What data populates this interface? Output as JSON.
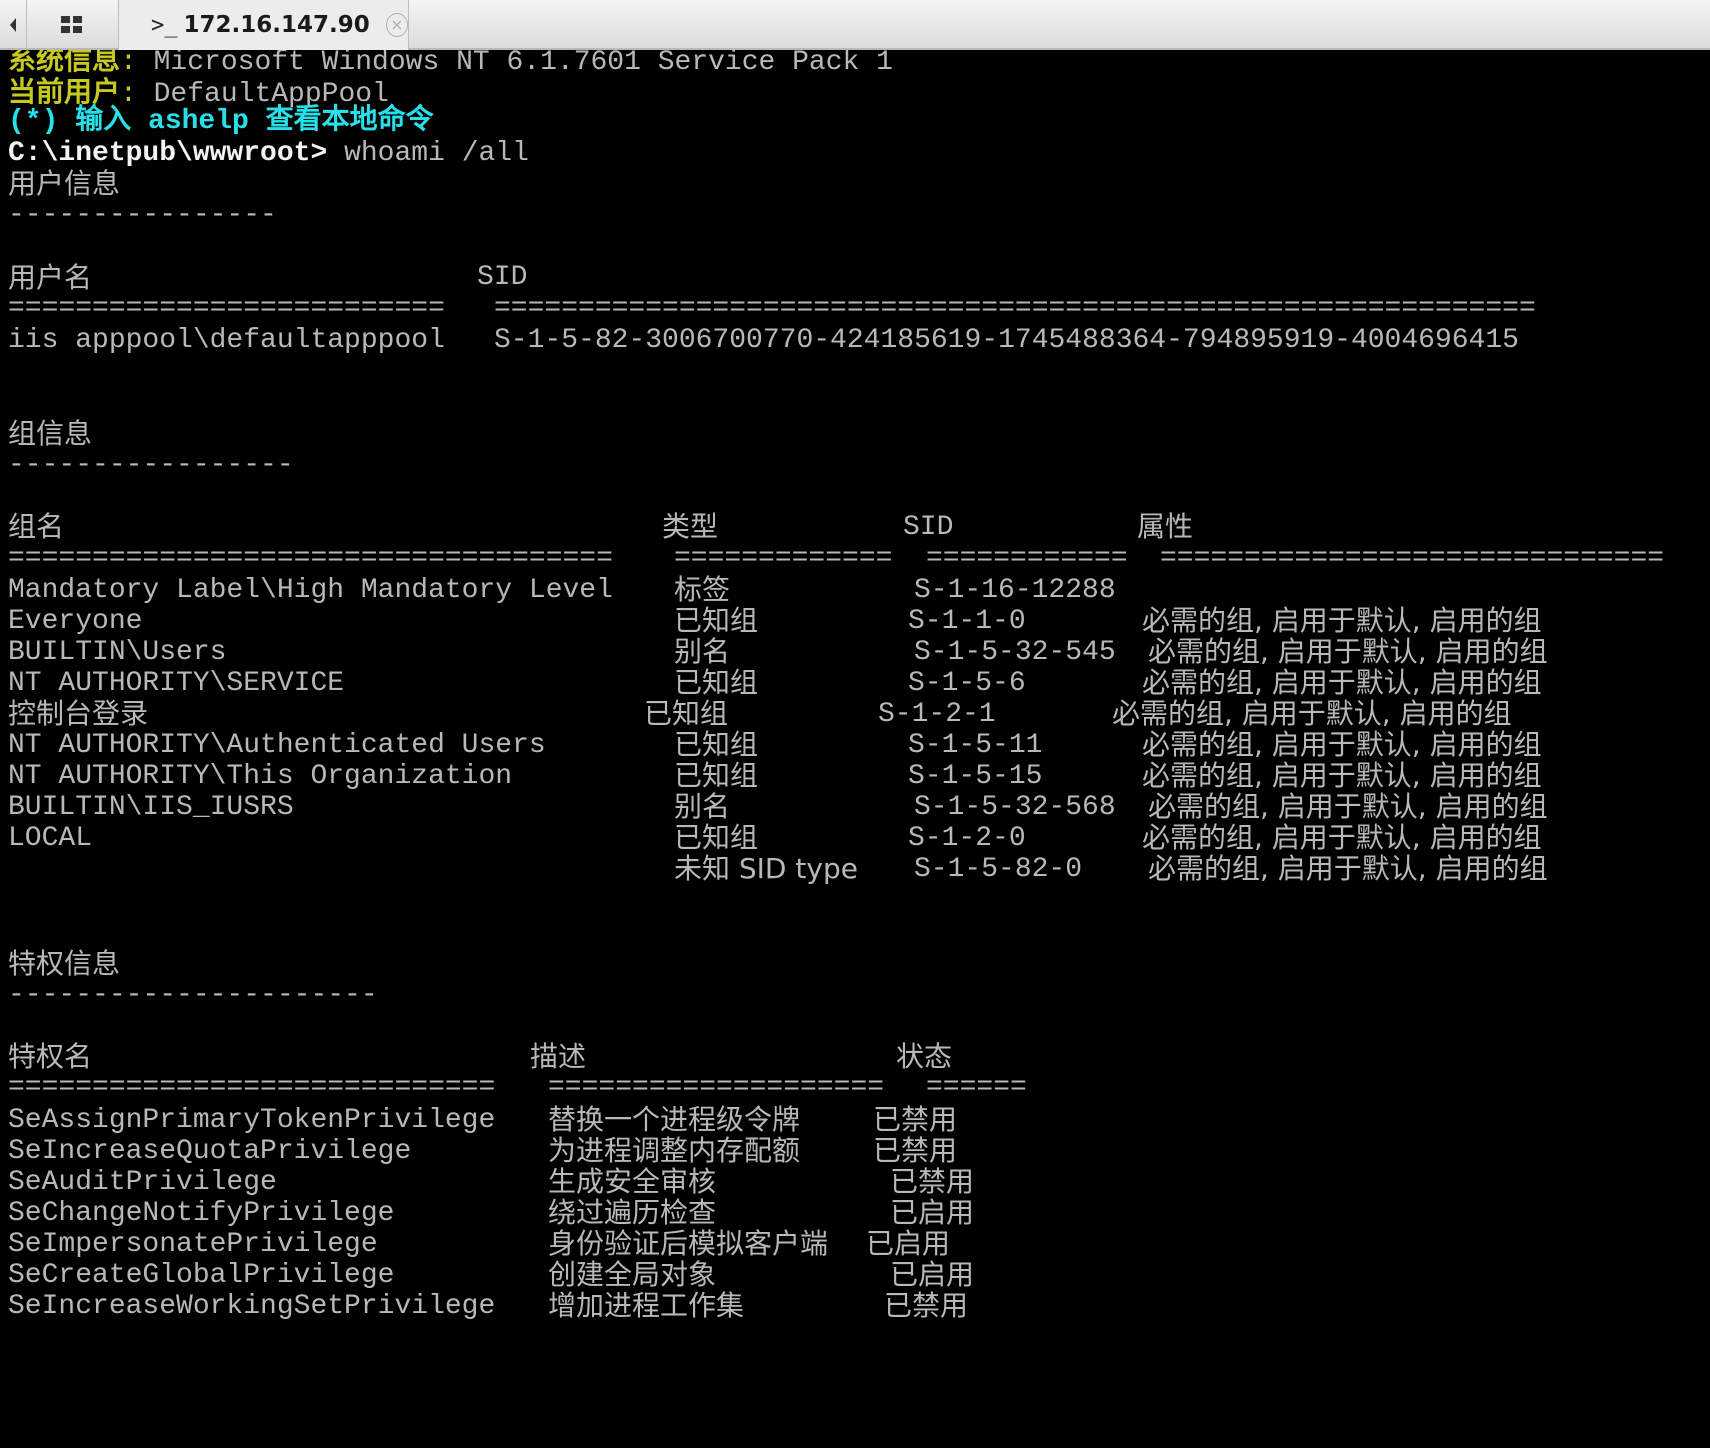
{
  "tab": {
    "title": "172.16.147.90",
    "prompt_icon": ">_",
    "close_icon": "×"
  },
  "banner": {
    "sysinfo_label": "系统信息",
    "sysinfo_value": "Microsoft Windows NT 6.1.7601 Service Pack 1",
    "user_label": "当前用户",
    "user_value": "DefaultAppPool",
    "hint": "(*) 输入 ashelp 查看本地命令",
    "prompt": "C:\\inetpub\\wwwroot>",
    "command": "whoami /all"
  },
  "user_info": {
    "title": "用户信息",
    "underline": "----------------",
    "col_name": "用户名",
    "col_sid": "SID",
    "sep_name": "==========================",
    "sep_sid": "==============================================================",
    "name": "iis apppool\\defaultapppool",
    "sid": "S-1-5-82-3006700770-424185619-1745488364-794895919-4004696415"
  },
  "group_info": {
    "title": "组信息",
    "underline": "-----------------",
    "col_name": "组名",
    "col_type": "类型",
    "col_sid": "SID",
    "col_attr": "属性",
    "sep_name": "====================================",
    "sep_type": "=============",
    "sep_sid": "============",
    "sep_attr": "==============================",
    "rows": [
      {
        "name": "Mandatory Label\\High Mandatory Level",
        "type": "标签",
        "sid": "S-1-16-12288",
        "attr": ""
      },
      {
        "name": "Everyone",
        "type": "已知组",
        "sid": "S-1-1-0",
        "attr": "必需的组, 启用于默认, 启用的组"
      },
      {
        "name": "BUILTIN\\Users",
        "type": "别名",
        "sid": "S-1-5-32-545",
        "attr": "必需的组, 启用于默认, 启用的组"
      },
      {
        "name": "NT AUTHORITY\\SERVICE",
        "type": "已知组",
        "sid": "S-1-5-6",
        "attr": "必需的组, 启用于默认, 启用的组"
      },
      {
        "name": "控制台登录",
        "type": "已知组",
        "sid": "S-1-2-1",
        "attr": "必需的组, 启用于默认, 启用的组"
      },
      {
        "name": "NT AUTHORITY\\Authenticated Users",
        "type": "已知组",
        "sid": "S-1-5-11",
        "attr": "必需的组, 启用于默认, 启用的组"
      },
      {
        "name": "NT AUTHORITY\\This Organization",
        "type": "已知组",
        "sid": "S-1-5-15",
        "attr": "必需的组, 启用于默认, 启用的组"
      },
      {
        "name": "BUILTIN\\IIS_IUSRS",
        "type": "别名",
        "sid": "S-1-5-32-568",
        "attr": "必需的组, 启用于默认, 启用的组"
      },
      {
        "name": "LOCAL",
        "type": "已知组",
        "sid": "S-1-2-0",
        "attr": "必需的组, 启用于默认, 启用的组"
      },
      {
        "name": "",
        "type": "未知 SID type",
        "sid": "S-1-5-82-0",
        "attr": "必需的组, 启用于默认, 启用的组"
      }
    ]
  },
  "privilege_info": {
    "title": "特权信息",
    "underline": "----------------------",
    "col_name": "特权名",
    "col_desc": "描述",
    "col_state": "状态",
    "sep_name": "=============================",
    "sep_desc": "====================",
    "sep_state": "======",
    "rows": [
      {
        "name": "SeAssignPrimaryTokenPrivilege",
        "desc": "替换一个进程级令牌",
        "state": "已禁用"
      },
      {
        "name": "SeIncreaseQuotaPrivilege",
        "desc": "为进程调整内存配额",
        "state": "已禁用"
      },
      {
        "name": "SeAuditPrivilege",
        "desc": "生成安全审核",
        "state": "已禁用"
      },
      {
        "name": "SeChangeNotifyPrivilege",
        "desc": "绕过遍历检查",
        "state": "已启用"
      },
      {
        "name": "SeImpersonatePrivilege",
        "desc": "身份验证后模拟客户端",
        "state": "已启用"
      },
      {
        "name": "SeCreateGlobalPrivilege",
        "desc": "创建全局对象",
        "state": "已启用"
      },
      {
        "name": "SeIncreaseWorkingSetPrivilege",
        "desc": "增加进程工作集",
        "state": "已禁用"
      }
    ]
  },
  "colors": {
    "label": "#c7c920",
    "hint": "#27e0ea",
    "prompt": "#f2f2f2",
    "text": "#b8b8b8",
    "background": "#000000"
  }
}
